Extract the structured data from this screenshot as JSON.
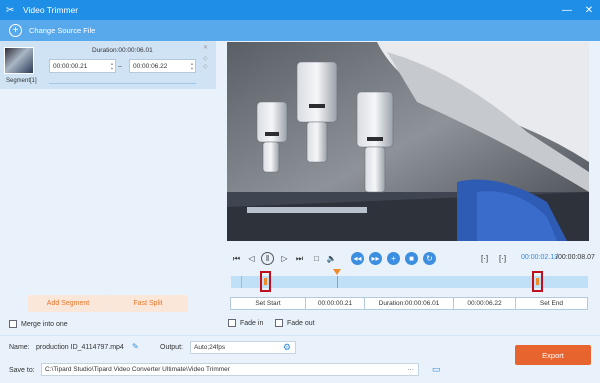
{
  "window": {
    "title": "Video Trimmer",
    "minimize_icon": "minus-icon",
    "close_icon": "close-icon"
  },
  "toolbar": {
    "change_source_label": "Change Source File"
  },
  "segment": {
    "label": "Segment[1]",
    "duration": "Duration:00:00:06.01",
    "start": "00:00:00.21",
    "end": "00:00:06.22",
    "separator": "–"
  },
  "left_buttons": {
    "add_segment": "Add Segment",
    "fast_split": "Fast Split"
  },
  "merge_label": "Merge into one",
  "playback": {
    "current_time": "00:00:02.13",
    "total_time": "/00:00:08.07"
  },
  "set_row": {
    "set_start_label": "Set Start",
    "start_value": "00:00:00.21",
    "duration": "Duration:00:00:06.01",
    "end_value": "00:00:06.22",
    "set_end_label": "Set End"
  },
  "fade": {
    "fade_in": "Fade in",
    "fade_out": "Fade out"
  },
  "output": {
    "name_label": "Name:",
    "name_value": "production ID_4114797.mp4",
    "output_label": "Output:",
    "output_value": "Auto;24fps",
    "save_label": "Save to:",
    "save_path": "C:\\Tipard Studio\\Tipard Video Converter Ultimate\\Video Trimmer",
    "browse_label": "···",
    "export_label": "Export"
  },
  "colors": {
    "accent": "#1e8ee6",
    "export": "#e8642f",
    "handle": "#c0101d"
  }
}
